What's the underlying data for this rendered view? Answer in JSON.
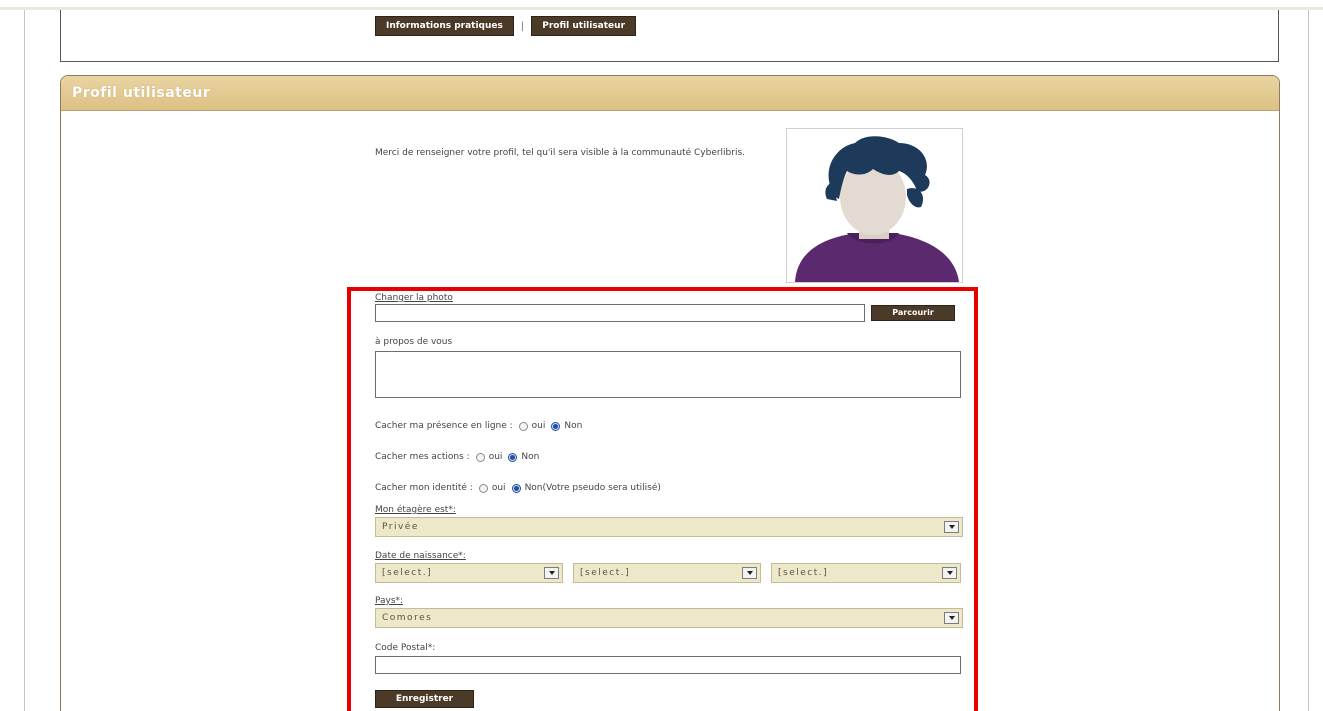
{
  "top_nav": {
    "tabs": [
      {
        "label": "Informations pratiques"
      },
      {
        "label": "Profil utilisateur"
      }
    ],
    "separator": "|"
  },
  "panel": {
    "title": "Profil utilisateur",
    "intro": "Merci de renseigner votre profil, tel qu'il sera visible à la communauté Cyberlibris."
  },
  "form": {
    "change_photo_label": "Changer la photo",
    "photo_value": "",
    "browse_label": "Parcourir",
    "about_label": "à propos de vous",
    "about_value": "",
    "hide_presence": {
      "label": "Cacher ma présence en ligne :",
      "yes": "oui",
      "no": "Non",
      "selected": "Non"
    },
    "hide_actions": {
      "label": "Cacher mes actions :",
      "yes": "oui",
      "no": "Non",
      "selected": "Non"
    },
    "hide_identity": {
      "label": "Cacher mon identité :",
      "yes": "oui",
      "no": "Non(Votre pseudo sera utilisé)",
      "selected": "Non"
    },
    "shelf_label": "Mon étagère est*:",
    "shelf_value": "Privée",
    "birth_label": "Date de naissance*:",
    "birth_day": "[select.]",
    "birth_month": "[select.]",
    "birth_year": "[select.]",
    "country_label": "Pays*:",
    "country_value": "Comores",
    "postal_label": "Code Postal*:",
    "postal_value": "",
    "save_label": "Enregistrer"
  },
  "colors": {
    "header_gold": "#ddc184",
    "button_brown": "#4b3a28",
    "select_bg": "#ede8c9",
    "highlight_red": "#e60000",
    "radio_blue": "#1f4f9e"
  }
}
